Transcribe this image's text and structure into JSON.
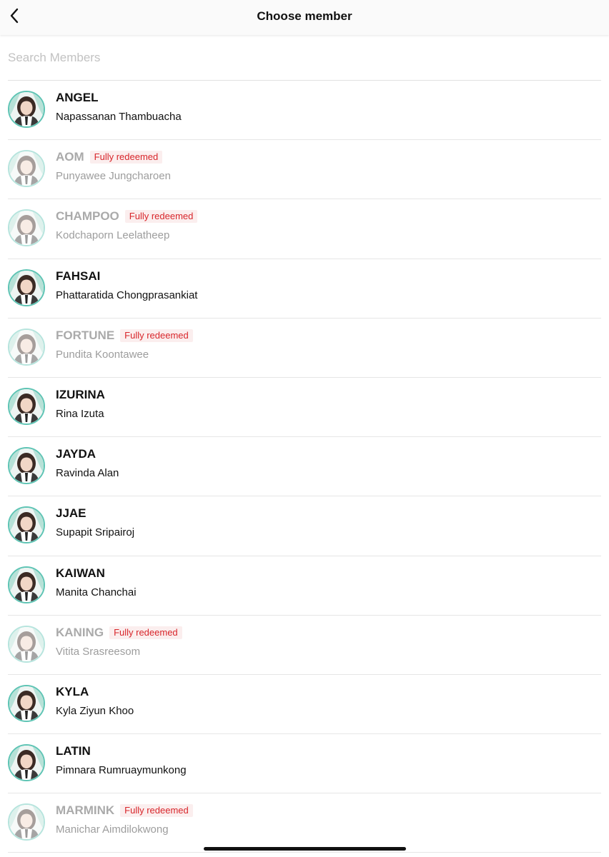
{
  "nav": {
    "title": "Choose member",
    "back_icon": "chevron-left-icon"
  },
  "search": {
    "placeholder": "Search Members",
    "value": ""
  },
  "badge_color": "#d8262b",
  "avatar_ring_color": "#5ec4b4",
  "members": [
    {
      "nickname": "ANGEL",
      "fullname": "Napassanan Thambuacha",
      "redeemed": false,
      "badge": ""
    },
    {
      "nickname": "AOM",
      "fullname": "Punyawee Jungcharoen",
      "redeemed": true,
      "badge": "Fully redeemed"
    },
    {
      "nickname": "CHAMPOO",
      "fullname": "Kodchaporn Leelatheep",
      "redeemed": true,
      "badge": "Fully redeemed"
    },
    {
      "nickname": "FAHSAI",
      "fullname": "Phattaratida Chongprasankiat",
      "redeemed": false,
      "badge": ""
    },
    {
      "nickname": "FORTUNE",
      "fullname": "Pundita Koontawee",
      "redeemed": true,
      "badge": "Fully redeemed"
    },
    {
      "nickname": "IZURINA",
      "fullname": "Rina Izuta",
      "redeemed": false,
      "badge": ""
    },
    {
      "nickname": "JAYDA",
      "fullname": "Ravinda Alan",
      "redeemed": false,
      "badge": ""
    },
    {
      "nickname": "JJAE",
      "fullname": "Supapit Sripairoj",
      "redeemed": false,
      "badge": ""
    },
    {
      "nickname": "KAIWAN",
      "fullname": "Manita Chanchai",
      "redeemed": false,
      "badge": ""
    },
    {
      "nickname": "KANING",
      "fullname": "Vitita Srasreesom",
      "redeemed": true,
      "badge": "Fully redeemed"
    },
    {
      "nickname": "KYLA",
      "fullname": "Kyla Ziyun Khoo",
      "redeemed": false,
      "badge": ""
    },
    {
      "nickname": "LATIN",
      "fullname": "Pimnara Rumruaymunkong",
      "redeemed": false,
      "badge": ""
    },
    {
      "nickname": "MARMINK",
      "fullname": "Manichar Aimdilokwong",
      "redeemed": true,
      "badge": "Fully redeemed"
    }
  ]
}
